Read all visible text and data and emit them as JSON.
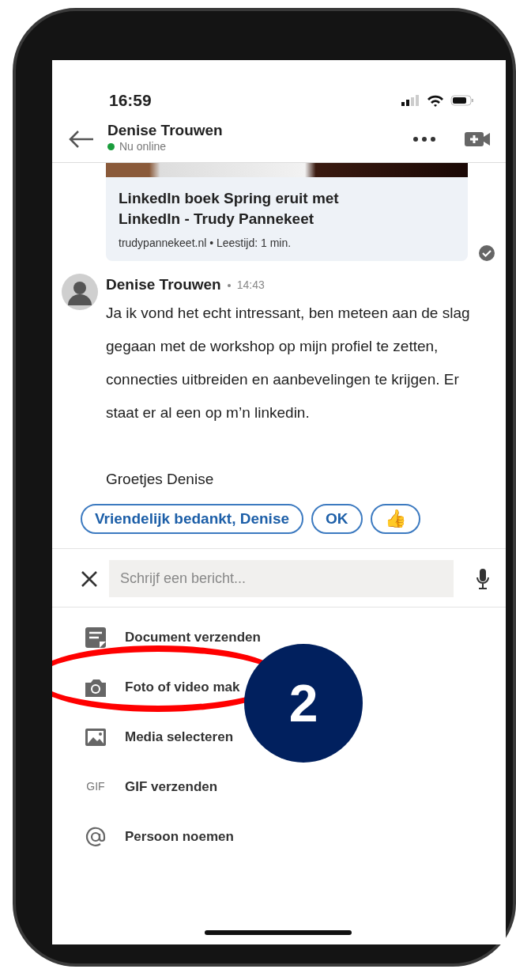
{
  "status_bar": {
    "time": "16:59"
  },
  "header": {
    "name": "Denise Trouwen",
    "presence": "Nu online",
    "online": true
  },
  "link_preview": {
    "title": "LinkedIn boek Spring eruit met LinkedIn - Trudy Pannekeet",
    "meta": "trudypannekeet.nl • Leestijd: 1 min.",
    "seen": true
  },
  "message": {
    "sender": "Denise Trouwen",
    "time": "14:43",
    "paragraphs": [
      "Ja ik vond het echt intressant, ben meteen aan de slag gegaan met de workshop op mijn profiel te zetten, connecties uitbreiden en aanbevelingen te krijgen. Er staat er al een op m’n linkedin.",
      "Groetjes Denise"
    ]
  },
  "quick_replies": [
    {
      "kind": "text",
      "label": "Vriendelijk bedankt, Denise"
    },
    {
      "kind": "text",
      "label": "OK"
    },
    {
      "kind": "emoji",
      "label": "👍"
    }
  ],
  "composer": {
    "placeholder": "Schrijf een bericht..."
  },
  "attach_menu": [
    {
      "kind": "document",
      "label": "Document verzenden"
    },
    {
      "kind": "camera",
      "label": "Foto of video mak"
    },
    {
      "kind": "media",
      "label": "Media selecteren"
    },
    {
      "kind": "gif",
      "icon_text": "GIF",
      "label": "GIF verzenden"
    },
    {
      "kind": "mention",
      "label": "Persoon noemen"
    }
  ],
  "annotation": {
    "step": "2"
  }
}
